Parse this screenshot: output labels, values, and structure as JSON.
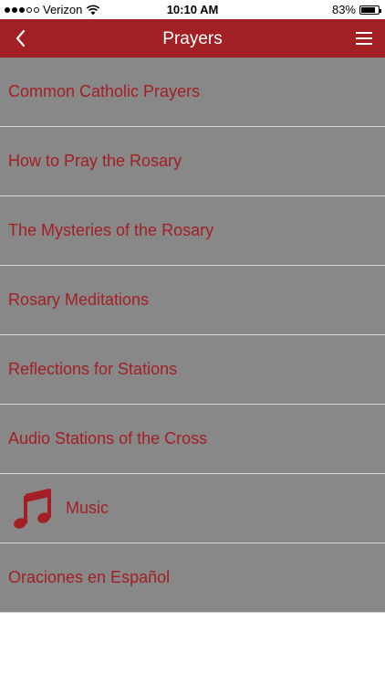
{
  "status_bar": {
    "carrier": "Verizon",
    "time": "10:10 AM",
    "battery_text": "83%",
    "battery_level": 0.83,
    "signal_bars": 3,
    "icons": [
      "signal-dots",
      "wifi-icon",
      "battery-icon"
    ]
  },
  "nav": {
    "title": "Prayers",
    "back_icon": "chevron-left-icon",
    "menu_icon": "hamburger-menu-icon"
  },
  "colors": {
    "brand_red": "#a21f24",
    "list_bg": "#888888",
    "divider": "#d5d5d5"
  },
  "list": [
    {
      "label": "Common Catholic Prayers"
    },
    {
      "label": "How to Pray the Rosary"
    },
    {
      "label": "The Mysteries of the Rosary"
    },
    {
      "label": "Rosary Meditations"
    },
    {
      "label": "Reflections for Stations"
    },
    {
      "label": "Audio Stations of the Cross"
    },
    {
      "label": "Music",
      "icon": "music-note-icon"
    },
    {
      "label": "Oraciones en Español"
    }
  ]
}
